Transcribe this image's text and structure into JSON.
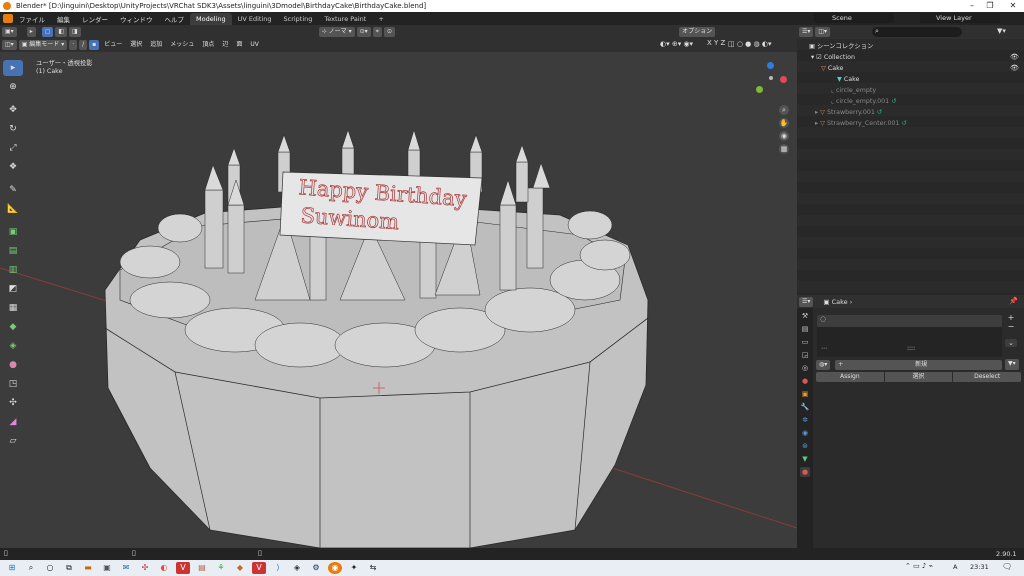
{
  "window": {
    "title": "Blender* [D:\\linguini\\Desktop\\UnityProjects\\VRChat SDK3\\Assets\\linguini\\3Dmodel\\BirthdayCake\\BirthdayCake.blend]"
  },
  "menu": [
    "ファイル",
    "編集",
    "レンダー",
    "ウィンドウ",
    "ヘルプ"
  ],
  "workspaces": [
    "Modeling",
    "UV Editing",
    "Scripting",
    "Texture Paint"
  ],
  "scene": {
    "label": "Scene",
    "view_layer": "View Layer"
  },
  "viewport_header": {
    "mode": "編集モード",
    "menus": [
      "ビュー",
      "選択",
      "追加",
      "メッシュ",
      "頂点",
      "辺",
      "面",
      "UV"
    ],
    "orientation": "ノーマ",
    "options": "オプション",
    "axes": [
      "X",
      "Y",
      "Z"
    ]
  },
  "viewport_info": {
    "line1": "ユーザー・透視投影",
    "line2": "(1) Cake"
  },
  "cake_text": {
    "line1": "Happy Birthday",
    "line2": "Suwinom"
  },
  "outliner": {
    "title": "シーンコレクション",
    "search_placeholder": "",
    "items": [
      {
        "label": "Collection"
      },
      {
        "label": "Cake"
      },
      {
        "label": "Cake"
      },
      {
        "label": "circle_empty"
      },
      {
        "label": "circle_empty.001"
      },
      {
        "label": "Strawberry.001"
      },
      {
        "label": "Strawberry_Center.001"
      }
    ]
  },
  "properties": {
    "object_name": "Cake",
    "new_label": "新規",
    "assign": "Assign",
    "select": "選択",
    "deselect": "Deselect"
  },
  "status": {
    "version": "2.90.1"
  },
  "taskbar": {
    "time": "23:31",
    "lang": "A"
  },
  "colors": {
    "accent": "#4772b3",
    "bg": "#393939",
    "grid": "#3c3c3c"
  }
}
